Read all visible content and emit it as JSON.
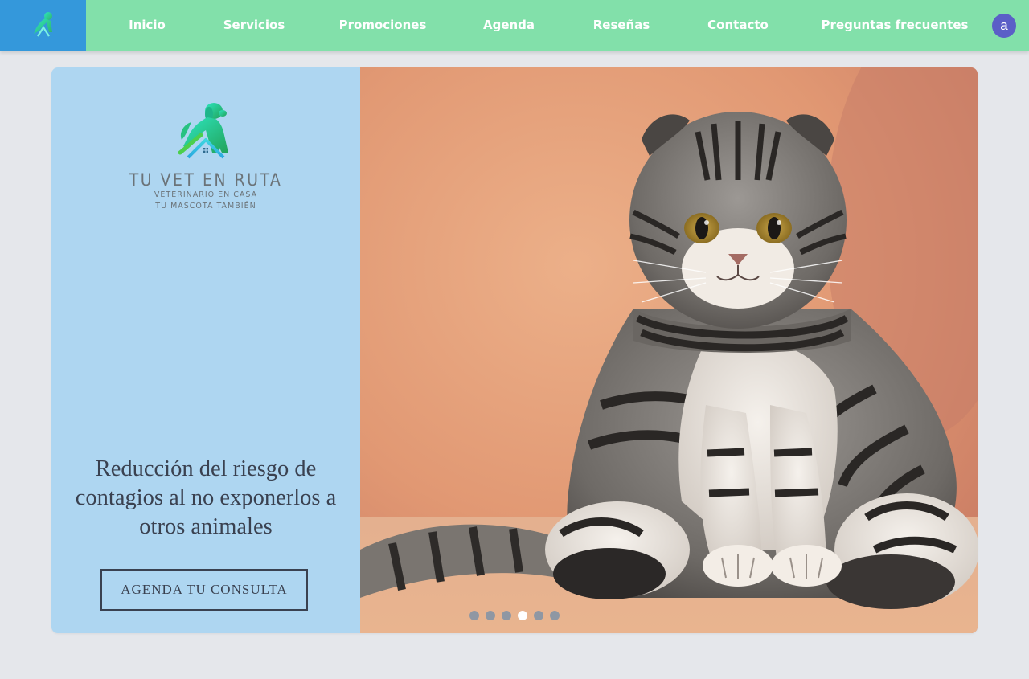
{
  "nav": {
    "links": [
      {
        "label": "Inicio"
      },
      {
        "label": "Servicios"
      },
      {
        "label": "Promociones"
      },
      {
        "label": "Agenda"
      },
      {
        "label": "Reseñas"
      },
      {
        "label": "Contacto"
      },
      {
        "label": "Preguntas frecuentes"
      }
    ],
    "avatar_letter": "a",
    "logo_icon": "pet-home-logo-icon"
  },
  "hero": {
    "brand_name": "TU VET EN RUTA",
    "brand_tagline_1": "VETERINARIO EN CASA",
    "brand_tagline_2": "TU MASCOTA TAMBIÉN",
    "title": "Reducción del riesgo de contagios al no exponerlos a otros animales",
    "cta_label": "AGENDA TU CONSULTA",
    "image_subject": "scottish-fold-tabby-cat",
    "slides_total": 6,
    "active_slide": 4
  },
  "colors": {
    "navbar": "#82e0aa",
    "logo_tile": "#3498db",
    "hero_left": "#aed6f1",
    "avatar": "#5b5fc7",
    "text_dark": "#3a4150",
    "page_bg": "#e5e7eb"
  }
}
